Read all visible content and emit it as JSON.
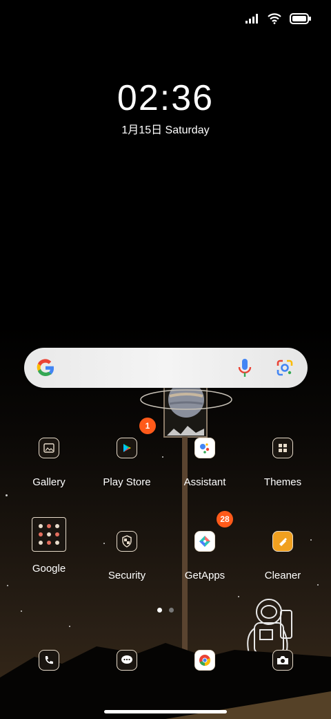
{
  "status_bar": {
    "signal": "signal-icon",
    "wifi": "wifi-icon",
    "battery": "battery-icon"
  },
  "clock": {
    "time": "02:36",
    "date": "1月15日 Saturday"
  },
  "search_bar": {
    "logo": "google-g-icon",
    "mic": "microphone-icon",
    "lens": "google-lens-icon"
  },
  "apps_row1": [
    {
      "label": "Gallery",
      "icon": "gallery-icon"
    },
    {
      "label": "Play Store",
      "icon": "play-store-icon",
      "badge": "1"
    },
    {
      "label": "Assistant",
      "icon": "assistant-icon"
    },
    {
      "label": "Themes",
      "icon": "themes-icon"
    }
  ],
  "apps_row2": [
    {
      "label": "Google",
      "icon": "google-folder-icon"
    },
    {
      "label": "Security",
      "icon": "security-icon"
    },
    {
      "label": "GetApps",
      "icon": "getapps-icon",
      "badge": "28"
    },
    {
      "label": "Cleaner",
      "icon": "cleaner-icon"
    }
  ],
  "page_indicator": {
    "pages": 2,
    "current": 1
  },
  "dock": [
    {
      "icon": "phone-icon"
    },
    {
      "icon": "messages-icon"
    },
    {
      "icon": "chrome-icon"
    },
    {
      "icon": "camera-icon"
    }
  ],
  "colors": {
    "badge": "#ff5a1a",
    "icon_border": "#e8dccb"
  }
}
